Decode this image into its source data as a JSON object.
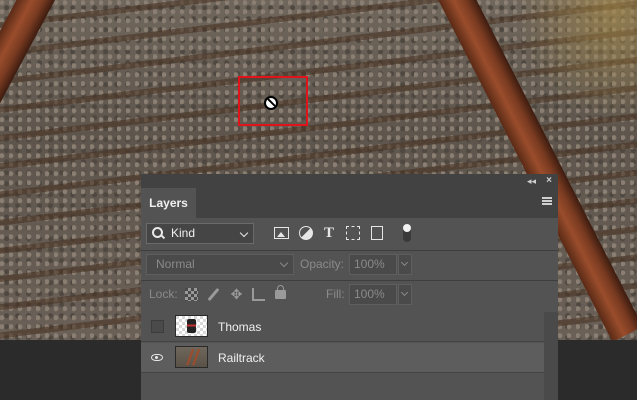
{
  "layers_panel": {
    "tab_label": "Layers",
    "filter": {
      "kind_label": "Kind",
      "icons": [
        "image-filter-icon",
        "adjustment-filter-icon",
        "type-filter-icon",
        "shape-filter-icon",
        "smart-object-filter-icon",
        "filter-toggle-icon"
      ]
    },
    "blend": {
      "mode": "Normal",
      "opacity_label": "Opacity:",
      "opacity_value": "100%"
    },
    "lock": {
      "lock_label": "Lock:",
      "fill_label": "Fill:",
      "fill_value": "100%"
    },
    "layers": [
      {
        "name": "Thomas",
        "visible": false
      },
      {
        "name": "Railtrack",
        "visible": true
      }
    ]
  },
  "canvas": {
    "selection_color": "#e1141c",
    "cursor": "not-allowed-icon"
  }
}
